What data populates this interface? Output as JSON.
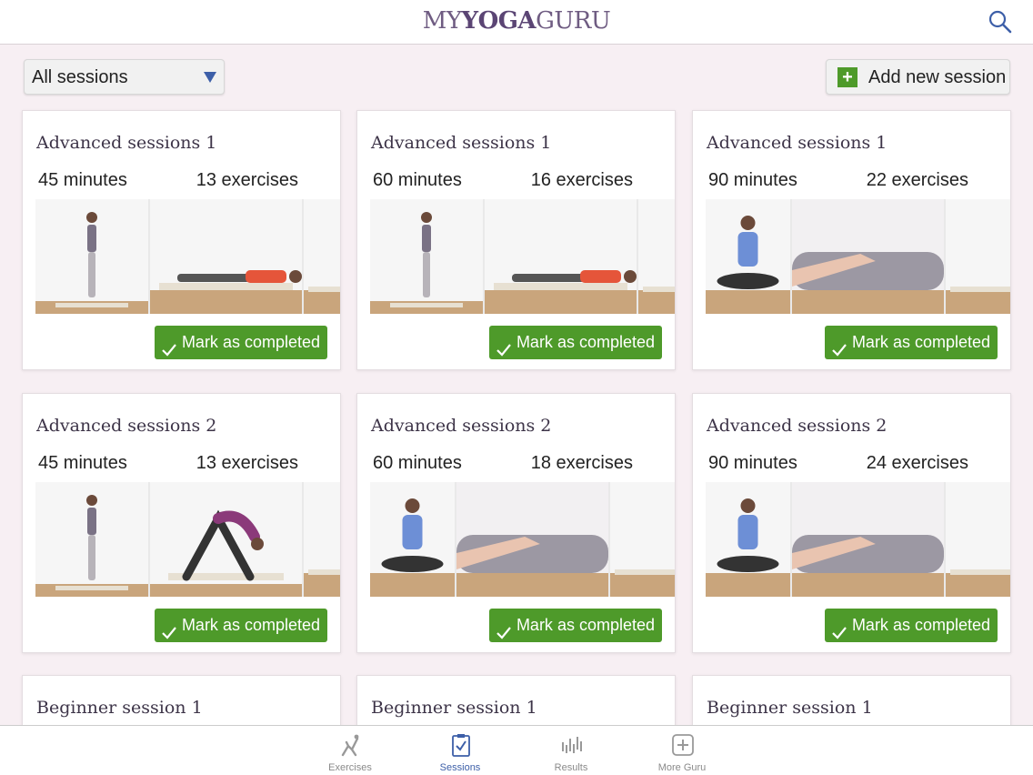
{
  "header": {
    "logo_parts": [
      "MY",
      "YOGA",
      "GURU"
    ],
    "search_icon": "search-icon"
  },
  "toolbar": {
    "filter_value": "All sessions",
    "add_label": "Add new session"
  },
  "colors": {
    "accent_green": "#4e9a2a",
    "logo_purple": "#6f5c82",
    "active_tab_blue": "#3d5fa8"
  },
  "sessions": [
    {
      "title": "Advanced sessions 1",
      "minutes": "45 minutes",
      "exercises": "13 exercises",
      "action": "Mark as completed"
    },
    {
      "title": "Advanced sessions 1",
      "minutes": "60 minutes",
      "exercises": "16 exercises",
      "action": "Mark as completed"
    },
    {
      "title": "Advanced sessions 1",
      "minutes": "90 minutes",
      "exercises": "22 exercises",
      "action": "Mark as completed"
    },
    {
      "title": "Advanced sessions 2",
      "minutes": "45 minutes",
      "exercises": "13 exercises",
      "action": "Mark as completed"
    },
    {
      "title": "Advanced sessions 2",
      "minutes": "60 minutes",
      "exercises": "18 exercises",
      "action": "Mark as completed"
    },
    {
      "title": "Advanced sessions 2",
      "minutes": "90 minutes",
      "exercises": "24 exercises",
      "action": "Mark as completed"
    },
    {
      "title": "Beginner session 1"
    },
    {
      "title": "Beginner session 1"
    },
    {
      "title": "Beginner session 1"
    }
  ],
  "tabbar": {
    "tabs": [
      {
        "label": "Exercises",
        "icon": "yoga-pose-icon"
      },
      {
        "label": "Sessions",
        "icon": "clipboard-check-icon"
      },
      {
        "label": "Results",
        "icon": "bar-chart-icon"
      },
      {
        "label": "More Guru",
        "icon": "plus-box-icon"
      }
    ],
    "active": "Sessions"
  }
}
